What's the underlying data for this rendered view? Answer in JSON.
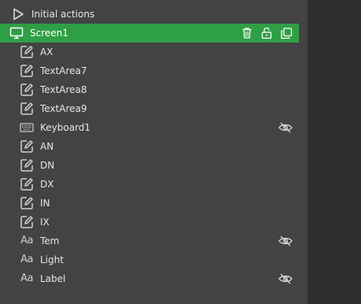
{
  "tree": {
    "initial_actions": {
      "label": "Initial actions",
      "icon": "play-outline-icon"
    },
    "screen": {
      "label": "Screen1",
      "icon": "monitor-icon",
      "actions": [
        "trash-icon",
        "unlock-icon",
        "copy-icon"
      ],
      "color": "#2f9f45"
    },
    "items": [
      {
        "label": "AX",
        "icon": "edit-icon",
        "hidden": false
      },
      {
        "label": "TextArea7",
        "icon": "edit-icon",
        "hidden": false
      },
      {
        "label": "TextArea8",
        "icon": "edit-icon",
        "hidden": false
      },
      {
        "label": "TextArea9",
        "icon": "edit-icon",
        "hidden": false
      },
      {
        "label": "Keyboard1",
        "icon": "keyboard-icon",
        "hidden": true
      },
      {
        "label": "AN",
        "icon": "edit-icon",
        "hidden": false
      },
      {
        "label": "DN",
        "icon": "edit-icon",
        "hidden": false
      },
      {
        "label": "DX",
        "icon": "edit-icon",
        "hidden": false
      },
      {
        "label": "IN",
        "icon": "edit-icon",
        "hidden": false
      },
      {
        "label": "IX",
        "icon": "edit-icon",
        "hidden": false
      },
      {
        "label": "Tem",
        "icon": "text-label-icon",
        "hidden": true
      },
      {
        "label": "Light",
        "icon": "text-label-icon",
        "hidden": false
      },
      {
        "label": "Label",
        "icon": "text-label-icon",
        "hidden": true
      }
    ]
  },
  "icon_glyph": {
    "aa": "Aa"
  }
}
